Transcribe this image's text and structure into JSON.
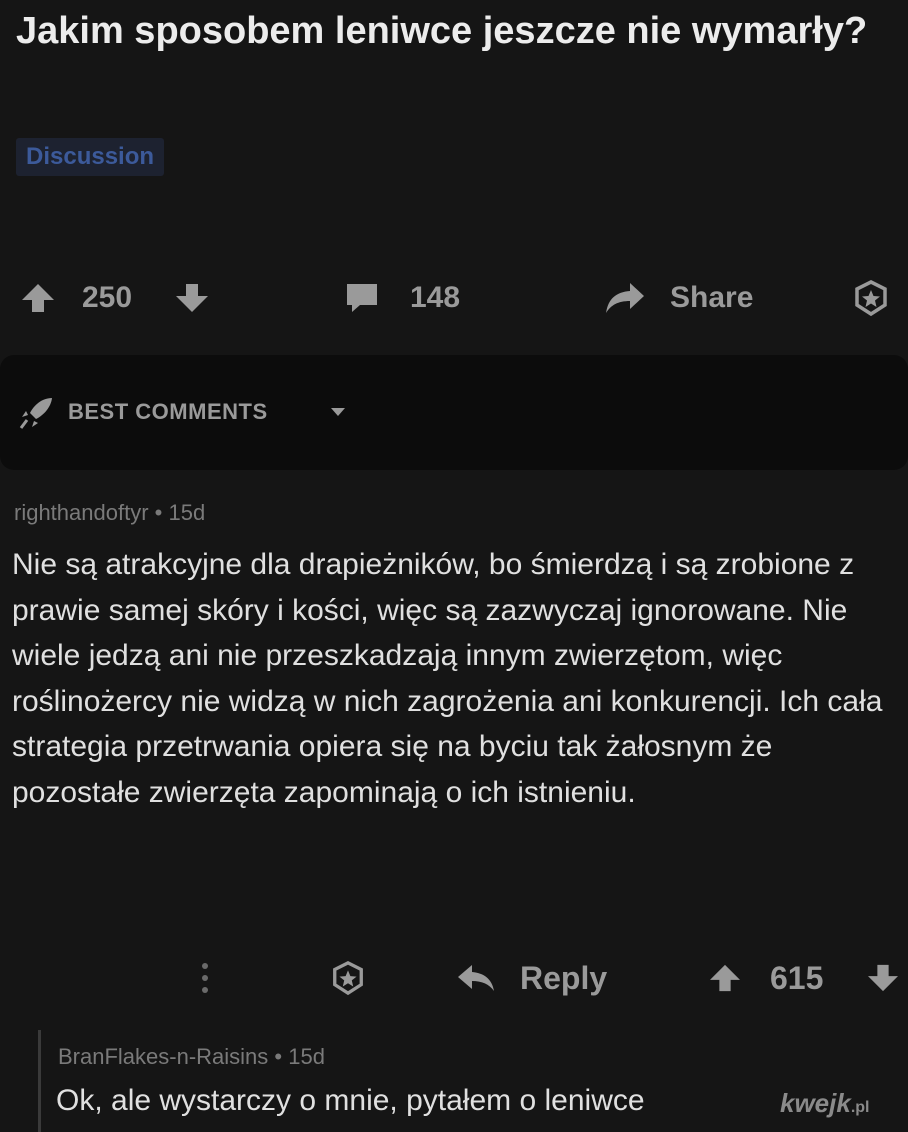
{
  "post": {
    "title": "Jakim sposobem leniwce jeszcze nie wymarły?",
    "flair": "Discussion",
    "score": "250",
    "comments_count": "148",
    "share_label": "Share"
  },
  "sort": {
    "label": "BEST COMMENTS"
  },
  "comment": {
    "author": "righthandoftyr",
    "age": "15d",
    "body": "Nie są atrakcyjne dla drapieżników, bo śmierdzą i są zrobione z prawie samej skóry i kości, więc są zazwyczaj ignorowane. Nie wiele jedzą ani nie przeszkadzają innym zwierzętom, więc roślinożercy nie widzą w nich zagrożenia ani konkurencji. Ich cała strategia przetrwania opiera się na byciu tak żałosnym że pozostałe zwierzęta zapominają o ich istnieniu.",
    "reply_label": "Reply",
    "score": "615"
  },
  "reply": {
    "author": "BranFlakes-n-Raisins",
    "age": "15d",
    "body": "Ok, ale wystarczy o mnie, pytałem o leniwce"
  },
  "watermark": {
    "brand": "kwejk",
    "tld": ".pl"
  },
  "separator": "•",
  "icons": [
    "upvote-icon",
    "downvote-icon",
    "comment-icon",
    "share-icon",
    "award-icon",
    "rocket-icon",
    "caret-down-icon",
    "more-icon",
    "reply-icon"
  ],
  "colors": {
    "background": "#151515",
    "flair_text": "#3c5a9a",
    "muted": "#9a9a9a"
  }
}
